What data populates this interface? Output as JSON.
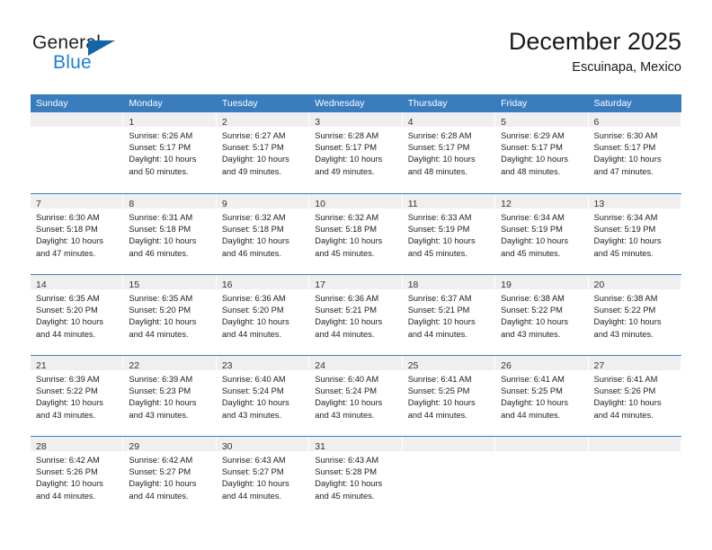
{
  "logo": {
    "word_one": "General",
    "word_two": "Blue",
    "triangle_color": "#1464aa",
    "blue_color": "#1f7fd1"
  },
  "header": {
    "title": "December 2025",
    "subtitle": "Escuinapa, Mexico"
  },
  "theme": {
    "header_blue": "#3a7dbf",
    "day_band_gray": "#efefef"
  },
  "weekdays": [
    "Sunday",
    "Monday",
    "Tuesday",
    "Wednesday",
    "Thursday",
    "Friday",
    "Saturday"
  ],
  "weeks": [
    [
      {
        "day": "",
        "sunrise": "",
        "sunset": "",
        "daylight1": "",
        "daylight2": ""
      },
      {
        "day": "1",
        "sunrise": "Sunrise: 6:26 AM",
        "sunset": "Sunset: 5:17 PM",
        "daylight1": "Daylight: 10 hours",
        "daylight2": "and 50 minutes."
      },
      {
        "day": "2",
        "sunrise": "Sunrise: 6:27 AM",
        "sunset": "Sunset: 5:17 PM",
        "daylight1": "Daylight: 10 hours",
        "daylight2": "and 49 minutes."
      },
      {
        "day": "3",
        "sunrise": "Sunrise: 6:28 AM",
        "sunset": "Sunset: 5:17 PM",
        "daylight1": "Daylight: 10 hours",
        "daylight2": "and 49 minutes."
      },
      {
        "day": "4",
        "sunrise": "Sunrise: 6:28 AM",
        "sunset": "Sunset: 5:17 PM",
        "daylight1": "Daylight: 10 hours",
        "daylight2": "and 48 minutes."
      },
      {
        "day": "5",
        "sunrise": "Sunrise: 6:29 AM",
        "sunset": "Sunset: 5:17 PM",
        "daylight1": "Daylight: 10 hours",
        "daylight2": "and 48 minutes."
      },
      {
        "day": "6",
        "sunrise": "Sunrise: 6:30 AM",
        "sunset": "Sunset: 5:17 PM",
        "daylight1": "Daylight: 10 hours",
        "daylight2": "and 47 minutes."
      }
    ],
    [
      {
        "day": "7",
        "sunrise": "Sunrise: 6:30 AM",
        "sunset": "Sunset: 5:18 PM",
        "daylight1": "Daylight: 10 hours",
        "daylight2": "and 47 minutes."
      },
      {
        "day": "8",
        "sunrise": "Sunrise: 6:31 AM",
        "sunset": "Sunset: 5:18 PM",
        "daylight1": "Daylight: 10 hours",
        "daylight2": "and 46 minutes."
      },
      {
        "day": "9",
        "sunrise": "Sunrise: 6:32 AM",
        "sunset": "Sunset: 5:18 PM",
        "daylight1": "Daylight: 10 hours",
        "daylight2": "and 46 minutes."
      },
      {
        "day": "10",
        "sunrise": "Sunrise: 6:32 AM",
        "sunset": "Sunset: 5:18 PM",
        "daylight1": "Daylight: 10 hours",
        "daylight2": "and 45 minutes."
      },
      {
        "day": "11",
        "sunrise": "Sunrise: 6:33 AM",
        "sunset": "Sunset: 5:19 PM",
        "daylight1": "Daylight: 10 hours",
        "daylight2": "and 45 minutes."
      },
      {
        "day": "12",
        "sunrise": "Sunrise: 6:34 AM",
        "sunset": "Sunset: 5:19 PM",
        "daylight1": "Daylight: 10 hours",
        "daylight2": "and 45 minutes."
      },
      {
        "day": "13",
        "sunrise": "Sunrise: 6:34 AM",
        "sunset": "Sunset: 5:19 PM",
        "daylight1": "Daylight: 10 hours",
        "daylight2": "and 45 minutes."
      }
    ],
    [
      {
        "day": "14",
        "sunrise": "Sunrise: 6:35 AM",
        "sunset": "Sunset: 5:20 PM",
        "daylight1": "Daylight: 10 hours",
        "daylight2": "and 44 minutes."
      },
      {
        "day": "15",
        "sunrise": "Sunrise: 6:35 AM",
        "sunset": "Sunset: 5:20 PM",
        "daylight1": "Daylight: 10 hours",
        "daylight2": "and 44 minutes."
      },
      {
        "day": "16",
        "sunrise": "Sunrise: 6:36 AM",
        "sunset": "Sunset: 5:20 PM",
        "daylight1": "Daylight: 10 hours",
        "daylight2": "and 44 minutes."
      },
      {
        "day": "17",
        "sunrise": "Sunrise: 6:36 AM",
        "sunset": "Sunset: 5:21 PM",
        "daylight1": "Daylight: 10 hours",
        "daylight2": "and 44 minutes."
      },
      {
        "day": "18",
        "sunrise": "Sunrise: 6:37 AM",
        "sunset": "Sunset: 5:21 PM",
        "daylight1": "Daylight: 10 hours",
        "daylight2": "and 44 minutes."
      },
      {
        "day": "19",
        "sunrise": "Sunrise: 6:38 AM",
        "sunset": "Sunset: 5:22 PM",
        "daylight1": "Daylight: 10 hours",
        "daylight2": "and 43 minutes."
      },
      {
        "day": "20",
        "sunrise": "Sunrise: 6:38 AM",
        "sunset": "Sunset: 5:22 PM",
        "daylight1": "Daylight: 10 hours",
        "daylight2": "and 43 minutes."
      }
    ],
    [
      {
        "day": "21",
        "sunrise": "Sunrise: 6:39 AM",
        "sunset": "Sunset: 5:22 PM",
        "daylight1": "Daylight: 10 hours",
        "daylight2": "and 43 minutes."
      },
      {
        "day": "22",
        "sunrise": "Sunrise: 6:39 AM",
        "sunset": "Sunset: 5:23 PM",
        "daylight1": "Daylight: 10 hours",
        "daylight2": "and 43 minutes."
      },
      {
        "day": "23",
        "sunrise": "Sunrise: 6:40 AM",
        "sunset": "Sunset: 5:24 PM",
        "daylight1": "Daylight: 10 hours",
        "daylight2": "and 43 minutes."
      },
      {
        "day": "24",
        "sunrise": "Sunrise: 6:40 AM",
        "sunset": "Sunset: 5:24 PM",
        "daylight1": "Daylight: 10 hours",
        "daylight2": "and 43 minutes."
      },
      {
        "day": "25",
        "sunrise": "Sunrise: 6:41 AM",
        "sunset": "Sunset: 5:25 PM",
        "daylight1": "Daylight: 10 hours",
        "daylight2": "and 44 minutes."
      },
      {
        "day": "26",
        "sunrise": "Sunrise: 6:41 AM",
        "sunset": "Sunset: 5:25 PM",
        "daylight1": "Daylight: 10 hours",
        "daylight2": "and 44 minutes."
      },
      {
        "day": "27",
        "sunrise": "Sunrise: 6:41 AM",
        "sunset": "Sunset: 5:26 PM",
        "daylight1": "Daylight: 10 hours",
        "daylight2": "and 44 minutes."
      }
    ],
    [
      {
        "day": "28",
        "sunrise": "Sunrise: 6:42 AM",
        "sunset": "Sunset: 5:26 PM",
        "daylight1": "Daylight: 10 hours",
        "daylight2": "and 44 minutes."
      },
      {
        "day": "29",
        "sunrise": "Sunrise: 6:42 AM",
        "sunset": "Sunset: 5:27 PM",
        "daylight1": "Daylight: 10 hours",
        "daylight2": "and 44 minutes."
      },
      {
        "day": "30",
        "sunrise": "Sunrise: 6:43 AM",
        "sunset": "Sunset: 5:27 PM",
        "daylight1": "Daylight: 10 hours",
        "daylight2": "and 44 minutes."
      },
      {
        "day": "31",
        "sunrise": "Sunrise: 6:43 AM",
        "sunset": "Sunset: 5:28 PM",
        "daylight1": "Daylight: 10 hours",
        "daylight2": "and 45 minutes."
      },
      {
        "day": "",
        "sunrise": "",
        "sunset": "",
        "daylight1": "",
        "daylight2": ""
      },
      {
        "day": "",
        "sunrise": "",
        "sunset": "",
        "daylight1": "",
        "daylight2": ""
      },
      {
        "day": "",
        "sunrise": "",
        "sunset": "",
        "daylight1": "",
        "daylight2": ""
      }
    ]
  ]
}
